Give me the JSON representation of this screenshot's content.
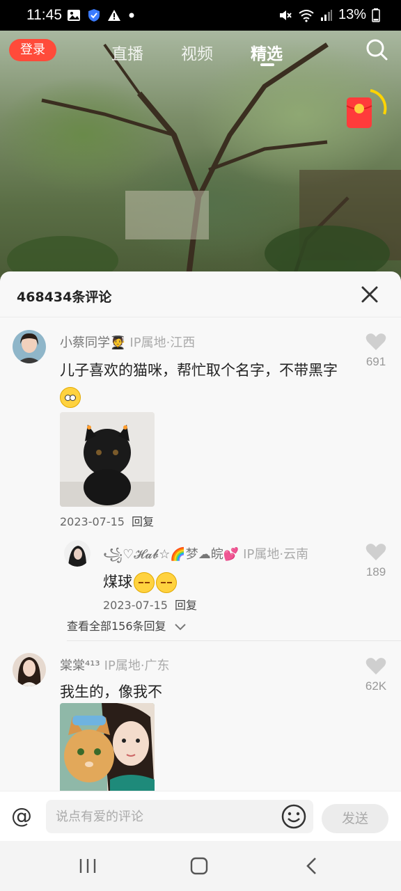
{
  "status_bar": {
    "time": "11:45",
    "battery": "13%",
    "icons": [
      "gallery-icon",
      "shield-icon",
      "warning-icon",
      "dot-icon",
      "mute-icon",
      "wifi-icon",
      "signal-icon",
      "battery-icon"
    ]
  },
  "header": {
    "login_label": "登录",
    "tabs": [
      {
        "label": "直播",
        "active": false
      },
      {
        "label": "视频",
        "active": false
      },
      {
        "label": "精选",
        "active": true
      }
    ]
  },
  "comments_panel": {
    "title": "468434条评论",
    "comments": [
      {
        "username": "小蔡同学🧑‍🎓",
        "ip": "IP属地·江西",
        "text": "儿子喜欢的猫咪，帮忙取个名字，不带黑字",
        "has_emoji": true,
        "date": "2023-07-15",
        "reply_label": "回复",
        "likes": "691",
        "replies": [
          {
            "username": "꧁♡𝓗𝓪𝓫☆🌈梦☁皖💕",
            "ip": "IP属地·云南",
            "text": "煤球",
            "date": "2023-07-15",
            "reply_label": "回复",
            "likes": "189"
          }
        ],
        "view_replies": "查看全部156条回复"
      },
      {
        "username": "棠棠⁴¹³",
        "ip": "IP属地·广东",
        "text": "我生的，像我不",
        "likes": "62K"
      }
    ]
  },
  "input_bar": {
    "placeholder": "说点有爱的评论",
    "send_label": "发送"
  },
  "colors": {
    "accent": "#ff4b3a",
    "panel_bg": "#f8f8f8",
    "muted_text": "#999999"
  }
}
